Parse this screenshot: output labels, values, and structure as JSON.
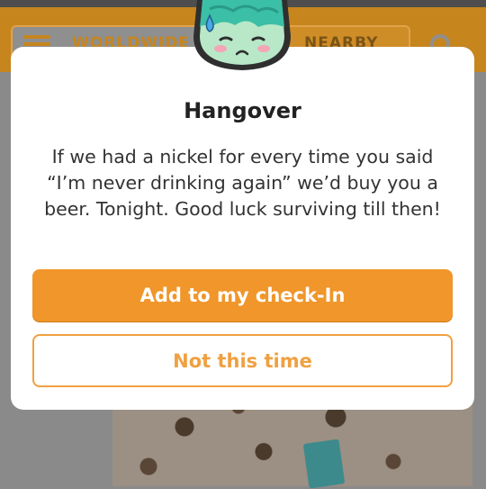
{
  "background": {
    "tabs": [
      {
        "label": "WORLDWIDE",
        "icon": "list-icon"
      },
      {
        "label": "NEARBY"
      }
    ],
    "search_icon": "search-icon"
  },
  "dialog": {
    "badge_icon": "hangover-badge-icon",
    "title": "Hangover",
    "body": "If we had a nickel for every time you said “I’m never drinking again” we’d buy you a beer. Tonight. Good luck surviving till then!",
    "primary_button": "Add to my check-In",
    "secondary_button": "Not this time"
  },
  "colors": {
    "accent": "#f0962a",
    "secondary_text": "#f0a040"
  }
}
